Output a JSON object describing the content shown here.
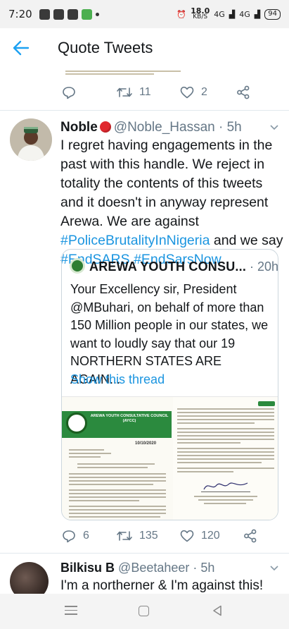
{
  "status_bar": {
    "time": "7:20",
    "net_speed_value": "18.0",
    "net_speed_unit": "KB/S",
    "network_1": "4G",
    "network_2": "4G",
    "battery": "94"
  },
  "header": {
    "title": "Quote Tweets"
  },
  "top_tweet": {
    "retweets": "11",
    "likes": "2"
  },
  "main_tweet": {
    "name": "Noble",
    "handle": "@Noble_Hassan",
    "time": "· 5h",
    "text_plain": "I regret having engagements in the past with this handle. We reject in totality the contents of this tweets and it doesn't in anyway represent Arewa. We are against ",
    "hashtag_1": "#PoliceBrutalityInNigeria",
    "text_mid": " and we say ",
    "hashtag_2": "#EndSARS",
    "hashtag_3": "#EndSarsNow",
    "quoted": {
      "name": "AREWA YOUTH CONSU...",
      "time": "· 20h",
      "text": "Your Excellency sir, President @MBuhari, on behalf of more than 150 Million people in our states, we want to loudly say that our 19 NORTHERN STATES ARE AGAIN...",
      "show_thread": "Show this thread",
      "doc_org": "AREWA YOUTH CONSULTATIVE COUNCIL (AYCC)",
      "doc_date": "10/10/2020"
    },
    "replies": "6",
    "retweets": "135",
    "likes": "120"
  },
  "reply_tweet": {
    "name": "Bilkisu B",
    "handle": "@Beetaheer",
    "time": "· 5h",
    "text": "I'm a northerner & I'm against this!"
  },
  "colors": {
    "accent": "#1da1f2",
    "link": "#1b95e0",
    "muted": "#657786",
    "divider": "#e1e8ed"
  }
}
